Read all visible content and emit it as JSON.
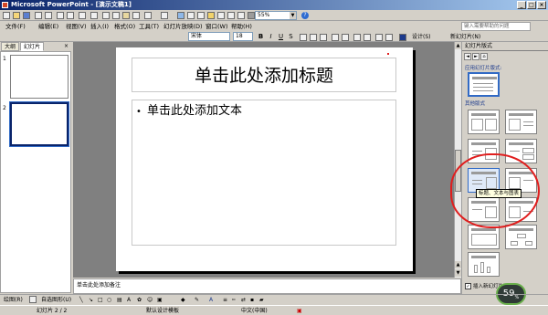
{
  "window": {
    "title": "Microsoft PowerPoint - [演示文稿1]"
  },
  "toolbar": {
    "zoom": "55%"
  },
  "menu": {
    "items": [
      "文件(F)",
      "编辑(E)",
      "视图(V)",
      "插入(I)",
      "格式(O)",
      "工具(T)",
      "幻灯片放映(D)",
      "窗口(W)",
      "帮助(H)"
    ],
    "help_placeholder": "键入需要帮助的问题"
  },
  "format_bar": {
    "font": "宋体",
    "size": "18",
    "bold": "B",
    "italic": "I",
    "underline": "U",
    "shadow": "S",
    "design": "设计(S)",
    "new_slide": "新幻灯片(N)"
  },
  "tabs": {
    "outline": "大纲",
    "slides": "幻灯片"
  },
  "slides": [
    {
      "num": "1"
    },
    {
      "num": "2"
    }
  ],
  "slide": {
    "title_placeholder": "单击此处添加标题",
    "body_placeholder": "单击此处添加文本",
    "bullet": "•"
  },
  "notes": {
    "placeholder": "单击此处添加备注"
  },
  "task_pane": {
    "title": "幻灯片版式",
    "applied_label": "应用幻灯片版式:",
    "other_label": "其他版式",
    "tooltip": "标题、文本与图表",
    "show_when_inserting": "插入新幻灯片时显示"
  },
  "draw_bar": {
    "draw": "绘图(R)",
    "autoshapes": "自选图形(U)"
  },
  "status": {
    "slide_count": "幻灯片 2 / 2",
    "design": "默认设计模板",
    "language": "中文(中国)"
  },
  "badge": {
    "value": "59",
    "unit": "%"
  }
}
